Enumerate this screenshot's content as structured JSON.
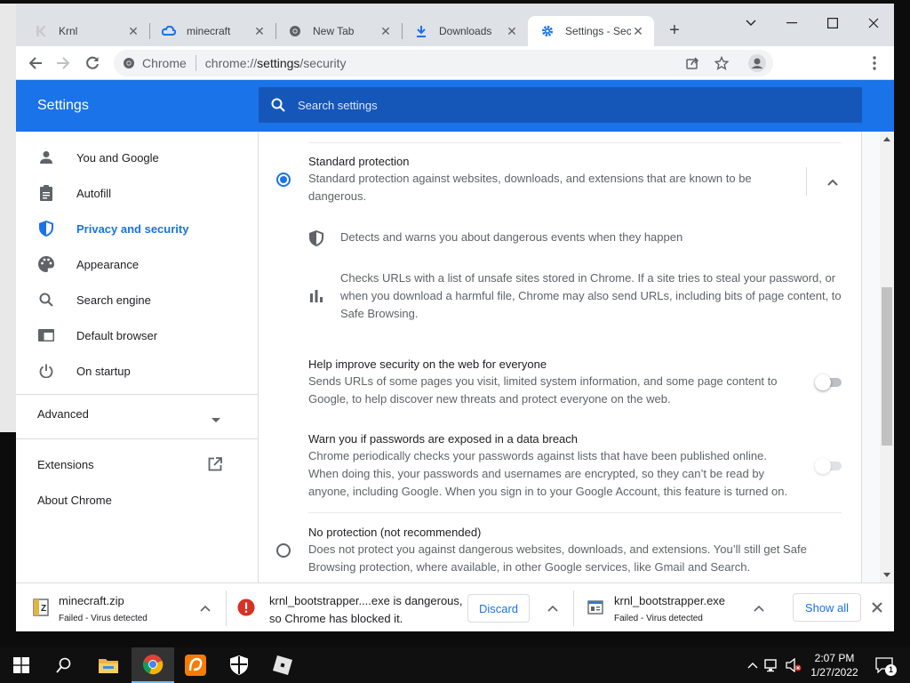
{
  "tabs": [
    {
      "title": "Krnl",
      "icon": "krnl-icon"
    },
    {
      "title": "minecraft",
      "icon": "cloud-icon"
    },
    {
      "title": "New Tab",
      "icon": "chrome-icon"
    },
    {
      "title": "Downloads",
      "icon": "download-icon"
    },
    {
      "title": "Settings - Secu",
      "icon": "gear-icon"
    }
  ],
  "toolbar": {
    "site_label": "Chrome",
    "url_scheme": "chrome://",
    "url_host": "settings",
    "url_path": "/security"
  },
  "settings": {
    "title": "Settings",
    "search_placeholder": "Search settings"
  },
  "sidebar": {
    "items": [
      {
        "label": "You and Google",
        "icon": "person-icon"
      },
      {
        "label": "Autofill",
        "icon": "clipboard-icon"
      },
      {
        "label": "Privacy and security",
        "icon": "shield-icon"
      },
      {
        "label": "Appearance",
        "icon": "palette-icon"
      },
      {
        "label": "Search engine",
        "icon": "search-icon"
      },
      {
        "label": "Default browser",
        "icon": "browser-icon"
      },
      {
        "label": "On startup",
        "icon": "power-icon"
      }
    ],
    "advanced": "Advanced",
    "extensions": "Extensions",
    "about": "About Chrome"
  },
  "security": {
    "standard": {
      "title": "Standard protection",
      "desc": "Standard protection against websites, downloads, and extensions that are known to be dangerous."
    },
    "detail1": "Detects and warns you about dangerous events when they happen",
    "detail2": "Checks URLs with a list of unsafe sites stored in Chrome. If a site tries to steal your password, or when you download a harmful file, Chrome may also send URLs, including bits of page content, to Safe Browsing.",
    "help_improve": {
      "title": "Help improve security on the web for everyone",
      "desc": "Sends URLs of some pages you visit, limited system information, and some page content to Google, to help discover new threats and protect everyone on the web.",
      "enabled": false
    },
    "password_warn": {
      "title": "Warn you if passwords are exposed in a data breach",
      "desc": "Chrome periodically checks your passwords against lists that have been published online. When doing this, your passwords and usernames are encrypted, so they can’t be read by anyone, including Google. When you sign in to your Google Account, this feature is turned on.",
      "enabled": false
    },
    "no_protection": {
      "title": "No protection (not recommended)",
      "desc": "Does not protect you against dangerous websites, downloads, and extensions. You’ll still get Safe Browsing protection, where available, in other Google services, like Gmail and Search."
    }
  },
  "downloads": {
    "item1": {
      "name": "minecraft.zip",
      "status": "Failed - Virus detected"
    },
    "item2": {
      "warning_line1": "krnl_bootstrapper....exe is dangerous,",
      "warning_line2": "so Chrome has blocked it.",
      "discard": "Discard"
    },
    "item3": {
      "name": "krnl_bootstrapper.exe",
      "status": "Failed - Virus detected"
    },
    "show_all": "Show all"
  },
  "taskbar": {
    "time": "2:07 PM",
    "date": "1/27/2022",
    "notification_count": "1"
  },
  "colors": {
    "accent": "#1a73e8",
    "header": "#1a73e8",
    "danger": "#d93025"
  }
}
